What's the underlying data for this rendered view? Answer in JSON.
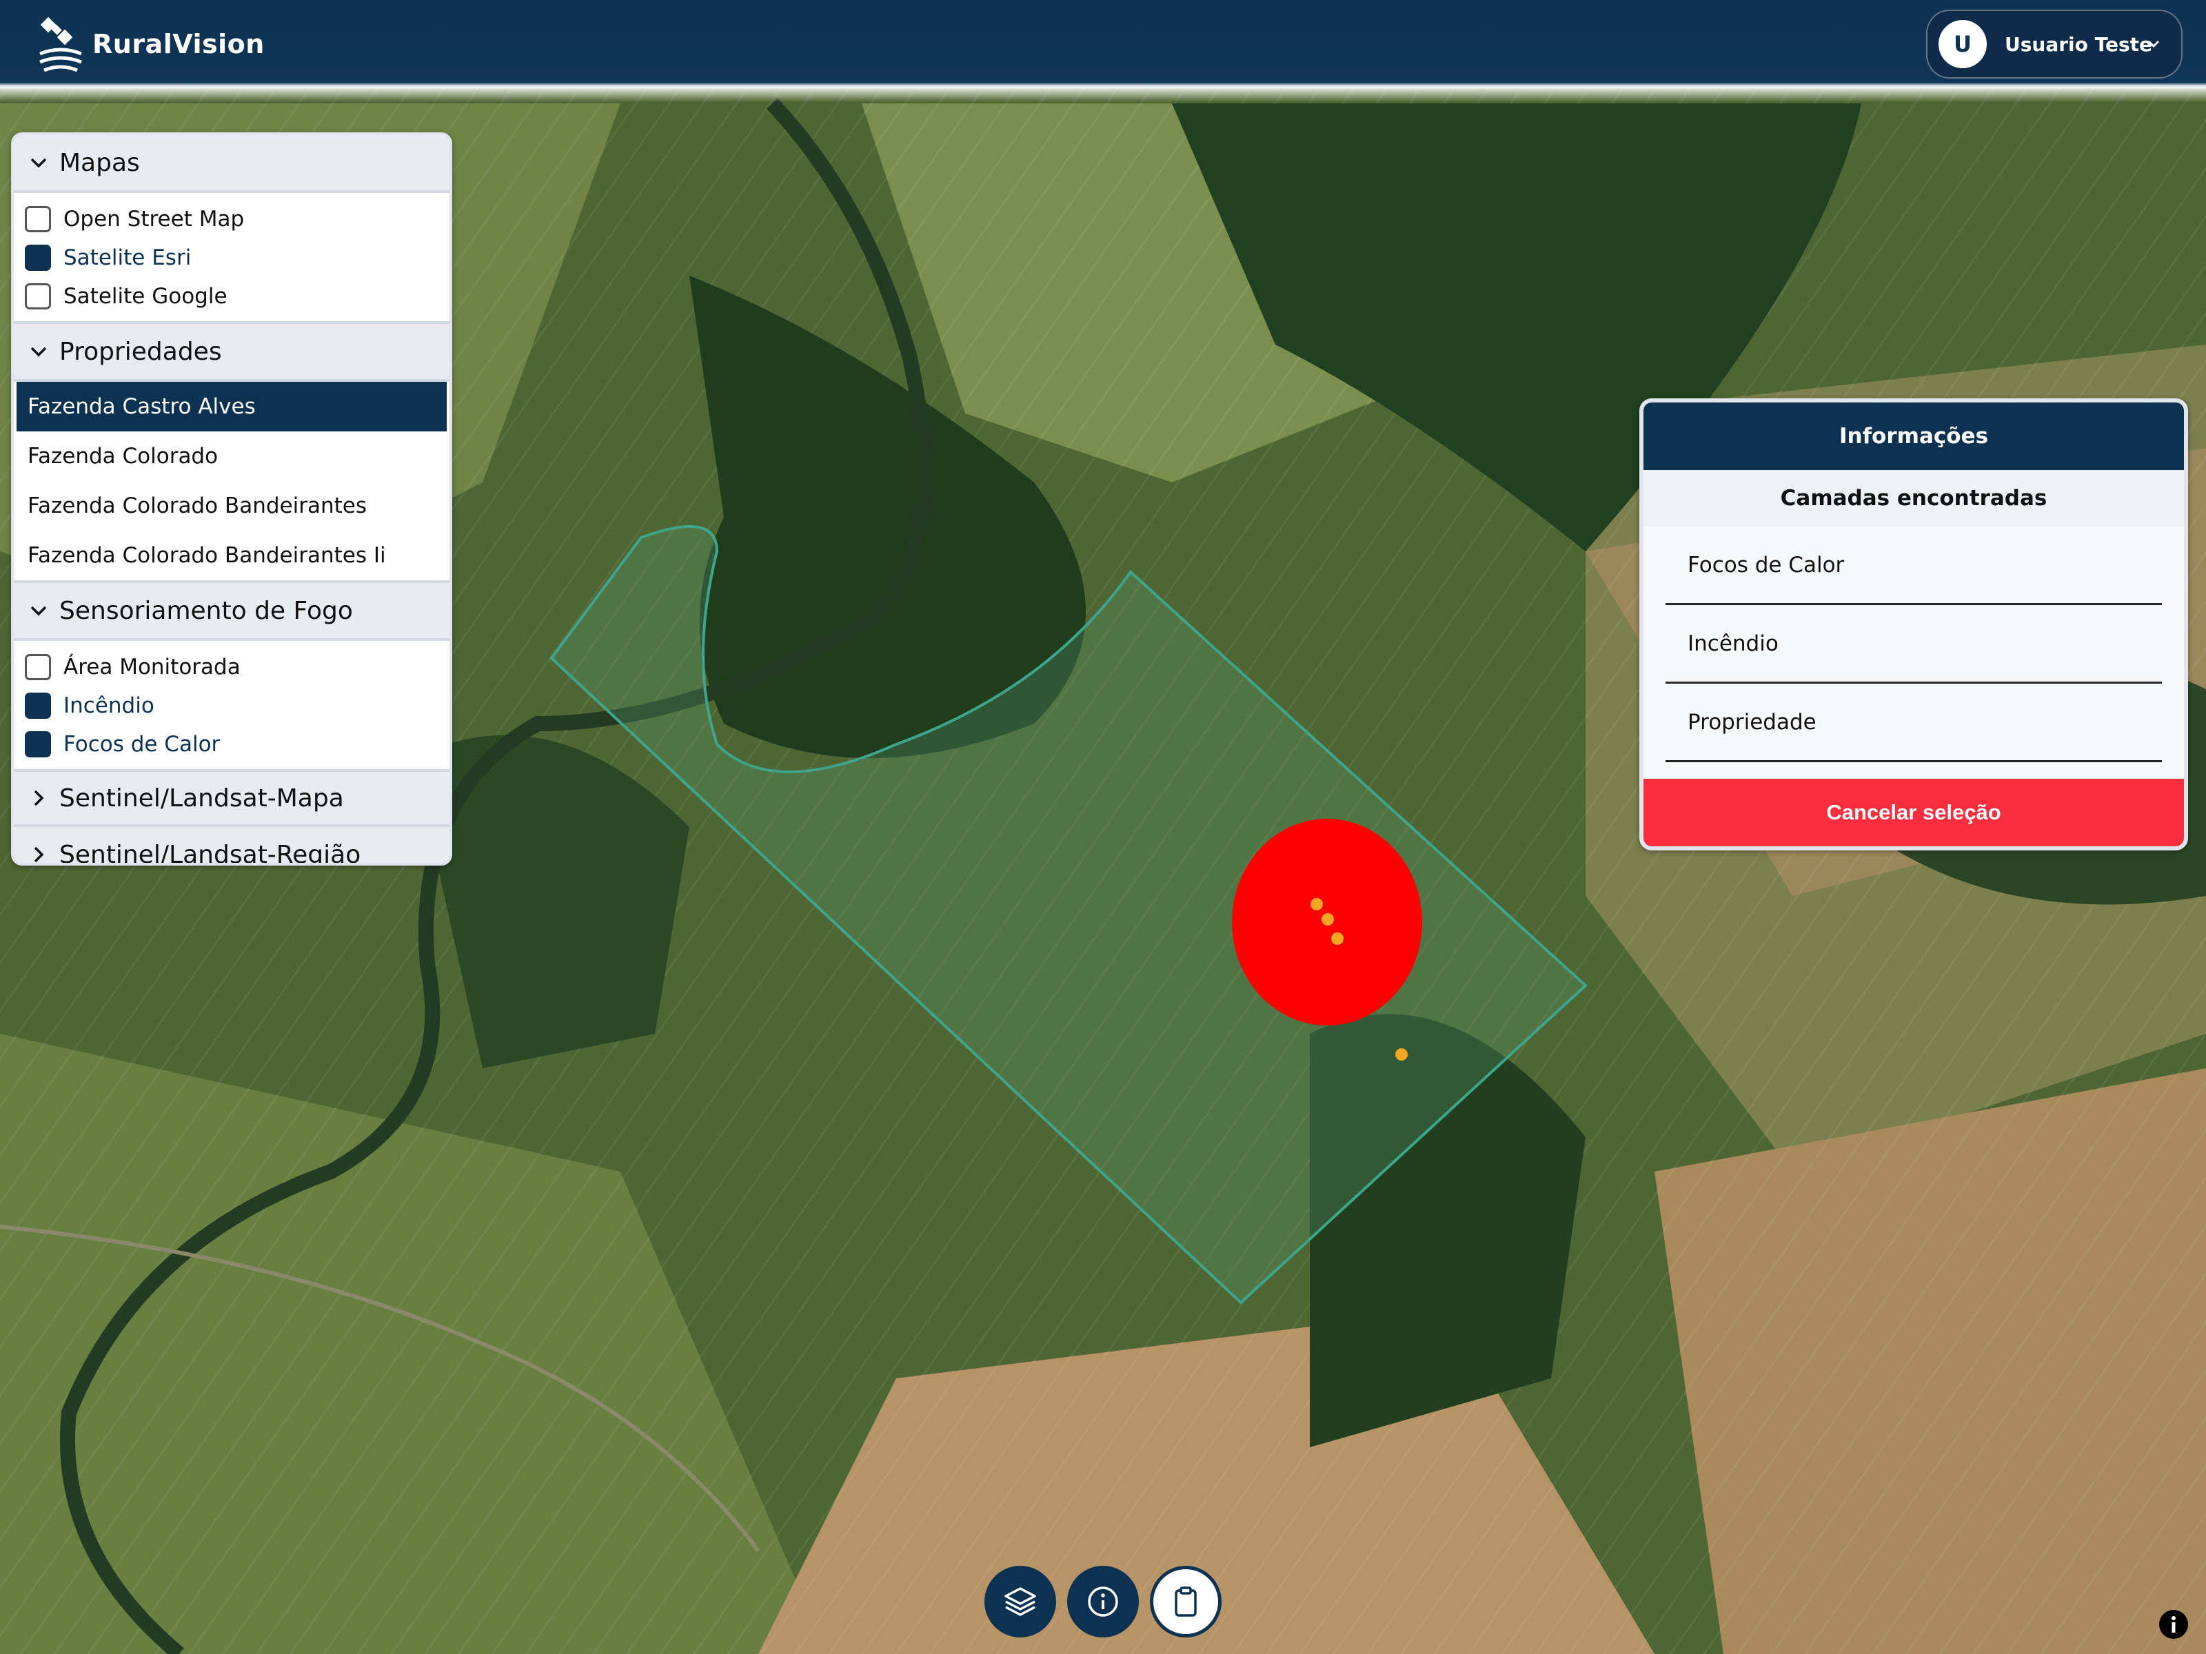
{
  "app": {
    "name": "RuralVision"
  },
  "user": {
    "initial": "U",
    "name": "Usuario Teste"
  },
  "layers_panel": {
    "groups": [
      {
        "title": "Mapas",
        "items": [
          {
            "label": "Open Street Map",
            "checked": false
          },
          {
            "label": "Satelite Esri",
            "checked": true
          },
          {
            "label": "Satelite Google",
            "checked": false
          }
        ]
      },
      {
        "title": "Propriedades",
        "items": [
          {
            "label": "Fazenda Castro Alves",
            "selected": true
          },
          {
            "label": "Fazenda Colorado",
            "selected": false
          },
          {
            "label": "Fazenda Colorado Bandeirantes",
            "selected": false
          },
          {
            "label": "Fazenda Colorado Bandeirantes Ii",
            "selected": false
          }
        ]
      },
      {
        "title": "Sensoriamento de Fogo",
        "items": [
          {
            "label": "Área Monitorada",
            "checked": false
          },
          {
            "label": "Incêndio",
            "checked": true
          },
          {
            "label": "Focos de Calor",
            "checked": true
          }
        ]
      },
      {
        "title": "Sentinel/Landsat-Mapa",
        "collapsed": true
      },
      {
        "title": "Sentinel/Landsat-Região",
        "collapsed": true
      }
    ]
  },
  "info_panel": {
    "title": "Informações",
    "subtitle": "Camadas encontradas",
    "layers": [
      "Focos de Calor",
      "Incêndio",
      "Propriedade"
    ],
    "cancel_label": "Cancelar seleção"
  },
  "toolbar": {
    "buttons": [
      {
        "name": "layers-button",
        "icon": "layers-icon"
      },
      {
        "name": "info-button",
        "icon": "info-icon"
      },
      {
        "name": "clipboard-button",
        "icon": "clipboard-icon"
      }
    ]
  },
  "colors": {
    "primary": "#0d3151",
    "danger": "#fa2d3e",
    "fire_area": "#ff0000",
    "heat_spot": "#f5a623",
    "property_outline": "#3fa58a"
  }
}
